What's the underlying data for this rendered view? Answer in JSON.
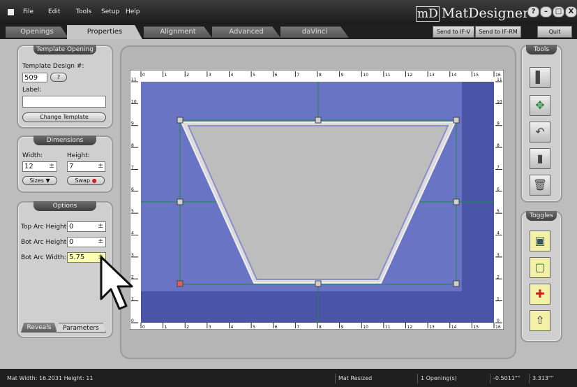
{
  "menubar": {
    "items": [
      "File",
      "Edit",
      "Tools",
      "Setup",
      "Help"
    ],
    "logo_mark": "mD",
    "logo_text": "MatDesigner",
    "win_buttons": [
      "?",
      "–",
      "□",
      "X"
    ]
  },
  "tabs": [
    {
      "label": "Openings",
      "active": false
    },
    {
      "label": "Properties",
      "active": true
    },
    {
      "label": "Alignment",
      "active": false
    },
    {
      "label": "Advanced",
      "active": false
    },
    {
      "label": "daVinci",
      "active": false
    }
  ],
  "top_buttons": {
    "send_ifv": "Send to IF-V",
    "send_ifrm": "Send to IF-RM",
    "quit": "Quit"
  },
  "template_panel": {
    "title": "Template Opening",
    "design_label": "Template Design #:",
    "design_value": "509",
    "help_glyph": "?",
    "label_label": "Label:",
    "label_value": "",
    "change_button": "Change Template"
  },
  "dimensions_panel": {
    "title": "Dimensions",
    "width_label": "Width:",
    "width_value": "12",
    "height_label": "Height:",
    "height_value": "7",
    "spin_glyph": "±",
    "sizes_button": "Sizes",
    "swap_button": "Swap"
  },
  "options_panel": {
    "title": "Options",
    "top_arc_label": "Top Arc Height:",
    "top_arc_value": "0",
    "bot_arc_label": "Bot Arc Height:",
    "bot_arc_value": "0",
    "bot_width_label": "Bot Arc Width:",
    "bot_width_value": "5.75",
    "tab_reveals": "Reveals",
    "tab_parameters": "Parameters"
  },
  "ruler": {
    "h_labels": [
      "0",
      "1",
      "2",
      "3",
      "4",
      "5",
      "6",
      "7",
      "8",
      "9",
      "10",
      "11",
      "12",
      "13",
      "14",
      "15",
      "16"
    ],
    "v_labels": [
      "11",
      "10",
      "9",
      "8",
      "7",
      "6",
      "5",
      "4",
      "3",
      "2",
      "1",
      "0"
    ]
  },
  "right_panel": {
    "tools_title": "Tools",
    "toggles_title": "Toggles",
    "tool_icons": [
      "ruler-edge-icon",
      "resize-arrows-icon",
      "undo-icon",
      "ruler-icon",
      "trash-icon"
    ],
    "toggle_icons": [
      "frame-icon",
      "inner-frame-icon",
      "crosshair-icon",
      "arrow-up-icon"
    ]
  },
  "status": {
    "mat_size": "Mat Width: 16.2031   Height: 11",
    "state": "Mat Resized",
    "openings": "1 Opening(s)",
    "coord_x": "-0.5011\"\"",
    "coord_y": "3.313\"\""
  },
  "colors": {
    "mat_blue": "#6a74c4",
    "mat_shadow": "#4b55a8",
    "opening_gray": "#bdbdbd",
    "guide_green": "#1f8a3a",
    "field_yellow": "#ffffb0"
  }
}
